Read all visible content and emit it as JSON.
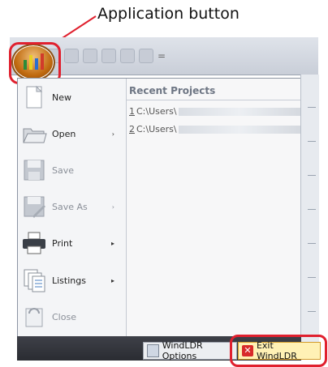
{
  "callout": {
    "label": "Application button"
  },
  "quick_access": {
    "dropdown_glyph": "="
  },
  "menu": {
    "left_items": [
      {
        "label": "New",
        "icon": "new-document-icon",
        "has_submenu": false,
        "enabled": true
      },
      {
        "label": "Open",
        "icon": "open-folder-icon",
        "has_submenu": true,
        "enabled": true
      },
      {
        "label": "Save",
        "icon": "save-disk-icon",
        "has_submenu": false,
        "enabled": false
      },
      {
        "label": "Save As",
        "icon": "save-as-icon",
        "has_submenu": true,
        "enabled": false
      },
      {
        "label": "Print",
        "icon": "printer-icon",
        "has_submenu": true,
        "enabled": true
      },
      {
        "label": "Listings",
        "icon": "listings-icon",
        "has_submenu": true,
        "enabled": true
      },
      {
        "label": "Close",
        "icon": "close-document-icon",
        "has_submenu": false,
        "enabled": false
      }
    ],
    "recent": {
      "title": "Recent Projects",
      "items": [
        {
          "number": "1",
          "path": "C:\\Users\\"
        },
        {
          "number": "2",
          "path": "C:\\Users\\"
        }
      ]
    },
    "footer": {
      "options_label": "WindLDR Options",
      "exit_label": "Exit WindLDR"
    }
  },
  "colors": {
    "highlight": "#e0202e",
    "menu_bg": "#f4f5f7",
    "footer_bg": "#2a2c32"
  }
}
